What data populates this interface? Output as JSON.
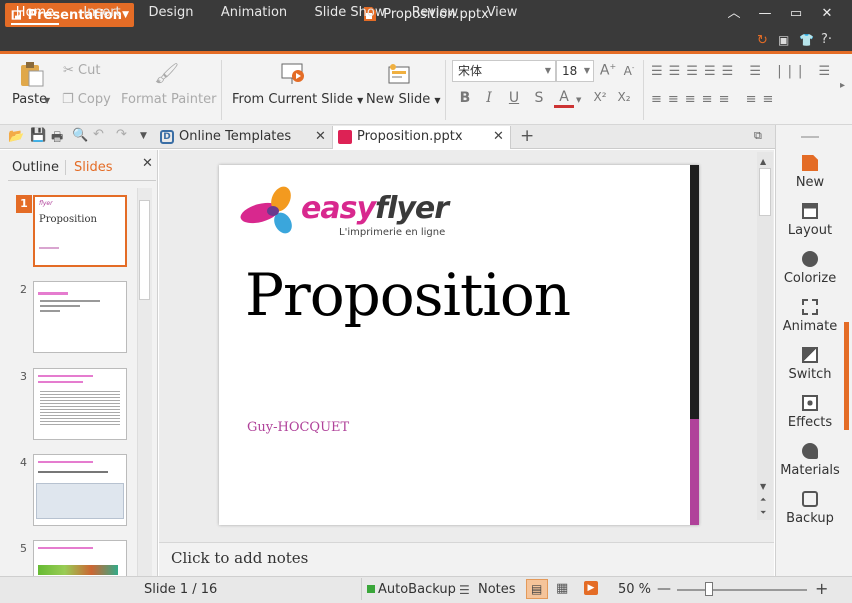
{
  "app": {
    "menu_label": "Presentation",
    "doc_title": "Proposition.pptx"
  },
  "menu_tabs": [
    {
      "label": "Home"
    },
    {
      "label": "Insert"
    },
    {
      "label": "Design"
    },
    {
      "label": "Animation"
    },
    {
      "label": "Slide Show"
    },
    {
      "label": "Review"
    },
    {
      "label": "View"
    }
  ],
  "ribbon": {
    "paste": "Paste",
    "cut": "Cut",
    "copy": "Copy",
    "format_painter": "Format Painter",
    "from_current": "From Current Slide",
    "new_slide": "New Slide",
    "font_name": "宋体",
    "font_size": "18"
  },
  "doc_tabs": [
    {
      "label": "Online Templates"
    },
    {
      "label": "Proposition.pptx"
    }
  ],
  "panel": {
    "outline": "Outline",
    "slides": "Slides"
  },
  "thumbs": [
    {
      "num": "1",
      "title": "Proposition"
    },
    {
      "num": "2"
    },
    {
      "num": "3"
    },
    {
      "num": "4"
    },
    {
      "num": "5"
    }
  ],
  "slide": {
    "logo_a": "easy",
    "logo_b": "flyer",
    "tagline": "L'imprimerie en ligne",
    "title": "Proposition",
    "author": "Guy-HOCQUET"
  },
  "notes": {
    "placeholder": "Click to add notes"
  },
  "right_panel": [
    {
      "label": "New"
    },
    {
      "label": "Layout"
    },
    {
      "label": "Colorize"
    },
    {
      "label": "Animate"
    },
    {
      "label": "Switch"
    },
    {
      "label": "Effects"
    },
    {
      "label": "Materials"
    },
    {
      "label": "Backup"
    }
  ],
  "status": {
    "slide": "Slide 1 / 16",
    "autobackup": "AutoBackup",
    "notes": "Notes",
    "zoom": "50 %",
    "zoom_level": 0.5
  },
  "colors": {
    "accent": "#e46c26",
    "magenta": "#b0429a",
    "dark": "#3a3a3a"
  }
}
